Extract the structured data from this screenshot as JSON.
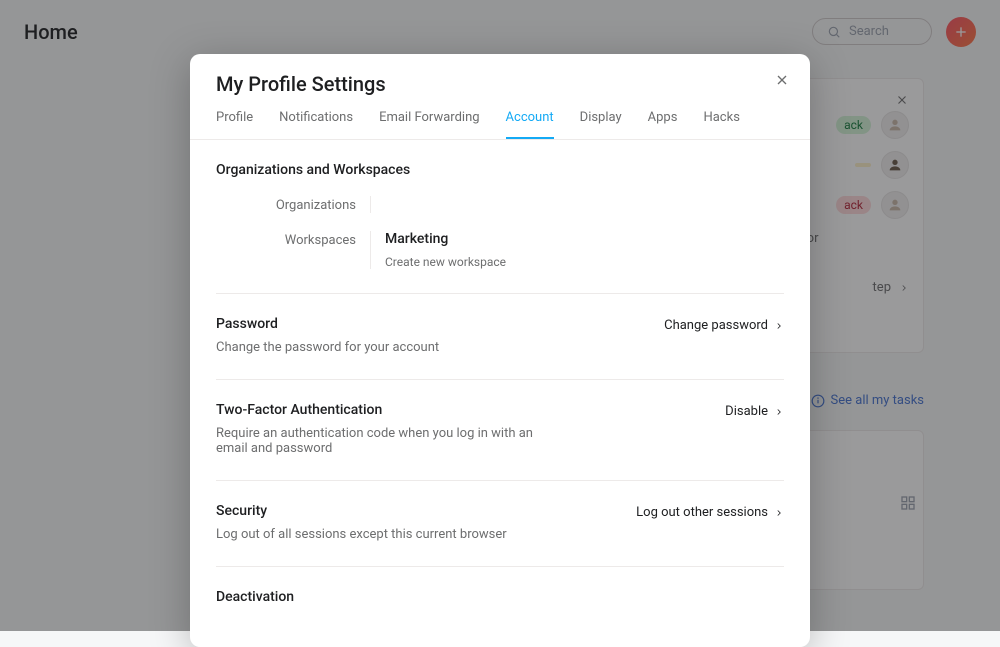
{
  "topbar": {
    "title": "Home",
    "search_placeholder": "Search"
  },
  "bg_card": {
    "pill1": "ack",
    "pill2": "",
    "pill3": "ack",
    "desc_fragment": "cts. Monitor",
    "step_fragment": "tep"
  },
  "see_all": "See all my tasks",
  "modal": {
    "title": "My Profile Settings",
    "tabs": [
      "Profile",
      "Notifications",
      "Email Forwarding",
      "Account",
      "Display",
      "Apps",
      "Hacks"
    ],
    "active_tab_index": 3,
    "sections": {
      "orgws": {
        "title": "Organizations and Workspaces",
        "org_label": "Organizations",
        "ws_label": "Workspaces",
        "ws_value": "Marketing",
        "ws_create": "Create new workspace"
      },
      "password": {
        "title": "Password",
        "desc": "Change the password for your account",
        "action": "Change password"
      },
      "twofa": {
        "title": "Two-Factor Authentication",
        "desc": "Require an authentication code when you log in with an email and password",
        "action": "Disable"
      },
      "security": {
        "title": "Security",
        "desc": "Log out of all sessions except this current browser",
        "action": "Log out other sessions"
      },
      "deactivation": {
        "title": "Deactivation"
      }
    }
  }
}
